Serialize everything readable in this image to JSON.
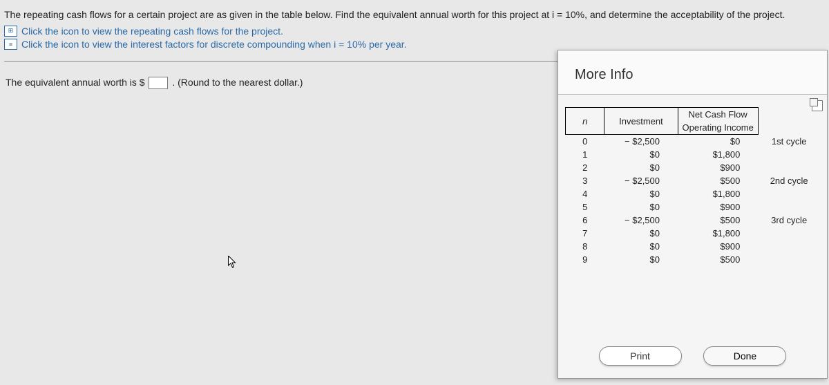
{
  "question": {
    "intro": "The repeating cash flows for a certain project are as given in the table below. Find the equivalent annual worth for this project at i = 10%, and determine the acceptability of the project.",
    "link1": "Click the icon to view the repeating cash flows for the project.",
    "link2": "Click the icon to view the interest factors for discrete compounding when i = 10% per year.",
    "answer_prefix": "The equivalent annual worth is $",
    "answer_suffix": ". (Round to the nearest dollar.)"
  },
  "modal": {
    "title": "More Info",
    "header_n": "n",
    "header_ncf": "Net Cash Flow",
    "header_inv": "Investment",
    "header_op": "Operating Income",
    "print": "Print",
    "done": "Done"
  },
  "rows": [
    {
      "n": "0",
      "inv": "− $2,500",
      "op": "$0",
      "cy": "1st cycle"
    },
    {
      "n": "1",
      "inv": "$0",
      "op": "$1,800",
      "cy": ""
    },
    {
      "n": "2",
      "inv": "$0",
      "op": "$900",
      "cy": ""
    },
    {
      "n": "3",
      "inv": "− $2,500",
      "op": "$500",
      "cy": "2nd cycle"
    },
    {
      "n": "4",
      "inv": "$0",
      "op": "$1,800",
      "cy": ""
    },
    {
      "n": "5",
      "inv": "$0",
      "op": "$900",
      "cy": ""
    },
    {
      "n": "6",
      "inv": "− $2,500",
      "op": "$500",
      "cy": "3rd cycle"
    },
    {
      "n": "7",
      "inv": "$0",
      "op": "$1,800",
      "cy": ""
    },
    {
      "n": "8",
      "inv": "$0",
      "op": "$900",
      "cy": ""
    },
    {
      "n": "9",
      "inv": "$0",
      "op": "$500",
      "cy": ""
    }
  ],
  "chart_data": {
    "type": "table",
    "title": "Repeating cash flows",
    "columns": [
      "n",
      "Investment",
      "Operating Income",
      "Cycle"
    ],
    "data": [
      [
        0,
        -2500,
        0,
        "1st cycle"
      ],
      [
        1,
        0,
        1800,
        ""
      ],
      [
        2,
        0,
        900,
        ""
      ],
      [
        3,
        -2500,
        500,
        "2nd cycle"
      ],
      [
        4,
        0,
        1800,
        ""
      ],
      [
        5,
        0,
        900,
        ""
      ],
      [
        6,
        -2500,
        500,
        "3rd cycle"
      ],
      [
        7,
        0,
        1800,
        ""
      ],
      [
        8,
        0,
        900,
        ""
      ],
      [
        9,
        0,
        500,
        ""
      ]
    ]
  }
}
